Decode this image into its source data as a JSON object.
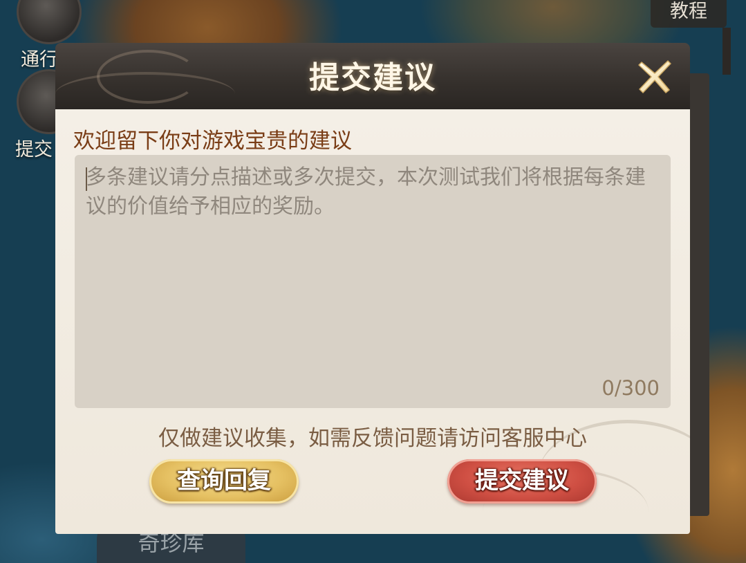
{
  "background": {
    "side_buttons": [
      {
        "label": "通行证"
      },
      {
        "label": "提交"
      }
    ],
    "tutorial_label": "教程",
    "bottom_tab_label": "奇珍库"
  },
  "dialog": {
    "title": "提交建议",
    "close_icon": "close-x-icon",
    "prompt": "欢迎留下你对游戏宝贵的建议",
    "textarea": {
      "value": "",
      "placeholder": "多条建议请分点描述或多次提交，本次测试我们将根据每条建议的价值给予相应的奖励。",
      "counter": "0/300"
    },
    "notice": "仅做建议收集，如需反馈问题请访问客服中心",
    "buttons": {
      "query_label": "查询回复",
      "submit_label": "提交建议"
    }
  },
  "colors": {
    "prompt": "#7a3d16",
    "query_button": "#e5c062",
    "submit_button": "#cf4f43",
    "panel": "#f4efe6",
    "textarea": "#d8d1c6"
  }
}
